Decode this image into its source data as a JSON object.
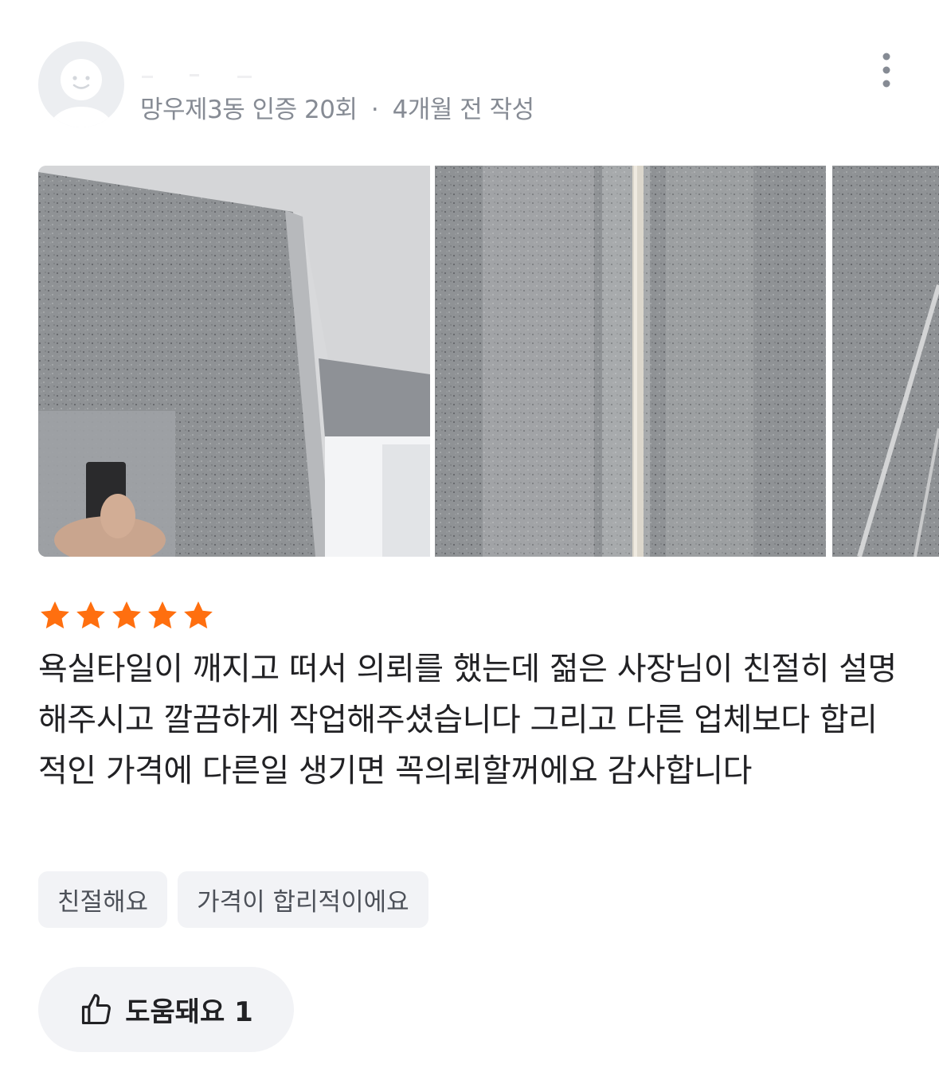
{
  "review": {
    "author": {
      "meta_location": "망우제3동 인증 20회",
      "meta_separator": "·",
      "meta_time": "4개월 전 작성"
    },
    "more_icon": "more-vertical-icon",
    "photos": [
      {
        "name": "review-photo-1",
        "subject": "bathroom mirror with gray tiles"
      },
      {
        "name": "review-photo-2",
        "subject": "gray tile wall with grout line"
      },
      {
        "name": "review-photo-3",
        "subject": "gray tile close-up"
      }
    ],
    "rating": 5,
    "rating_max": 5,
    "star_color": "#ff6f0f",
    "text": "욕실타일이 깨지고 떠서 의뢰를 했는데 젊은 사장님이 친절히 설명해주시고 깔끔하게 작업해주셨습니다 그리고 다른 업체보다 합리적인 가격에 다른일 생기면 꼭의뢰할꺼에요 감사합니다",
    "tags": [
      "친절해요",
      "가격이 합리적이에요"
    ],
    "helpful": {
      "icon": "thumbs-up-icon",
      "label": "도움돼요 1"
    }
  }
}
